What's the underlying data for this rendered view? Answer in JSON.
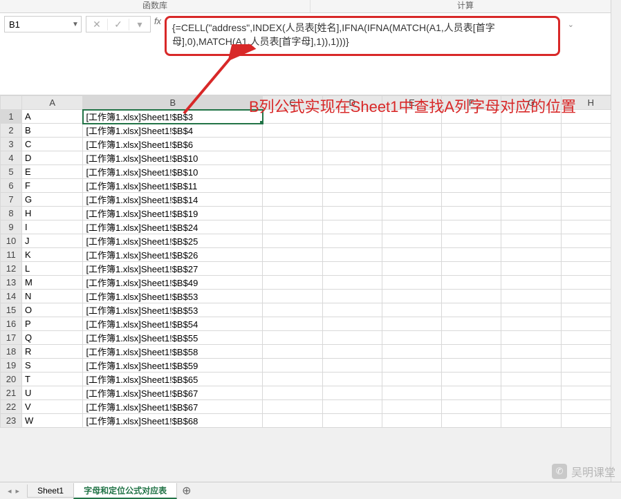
{
  "ribbon": {
    "group1": "函数库",
    "group2": "计算"
  },
  "nameBox": "B1",
  "fx_cancel": "✕",
  "fx_confirm": "✓",
  "fx_drop": "▾",
  "fx_label": "fx",
  "formula": "{=CELL(\"address\",INDEX(人员表[姓名],IFNA(IFNA(MATCH(A1,人员表[首字母],0),MATCH(A1,人员表[首字母],1)),1)))}",
  "expand_glyph": "⌄",
  "columns": [
    "A",
    "B",
    "C",
    "D",
    "E",
    "F",
    "G",
    "H"
  ],
  "annotation": "B列公式实现在Sheet1中查找A列字母对应的位置",
  "rows": [
    {
      "n": "1",
      "a": "A",
      "b": "[工作簿1.xlsx]Sheet1!$B$3"
    },
    {
      "n": "2",
      "a": "B",
      "b": "[工作簿1.xlsx]Sheet1!$B$4"
    },
    {
      "n": "3",
      "a": "C",
      "b": "[工作簿1.xlsx]Sheet1!$B$6"
    },
    {
      "n": "4",
      "a": "D",
      "b": "[工作簿1.xlsx]Sheet1!$B$10"
    },
    {
      "n": "5",
      "a": "E",
      "b": "[工作簿1.xlsx]Sheet1!$B$10"
    },
    {
      "n": "6",
      "a": "F",
      "b": "[工作簿1.xlsx]Sheet1!$B$11"
    },
    {
      "n": "7",
      "a": "G",
      "b": "[工作簿1.xlsx]Sheet1!$B$14"
    },
    {
      "n": "8",
      "a": "H",
      "b": "[工作簿1.xlsx]Sheet1!$B$19"
    },
    {
      "n": "9",
      "a": "I",
      "b": "[工作簿1.xlsx]Sheet1!$B$24"
    },
    {
      "n": "10",
      "a": "J",
      "b": "[工作簿1.xlsx]Sheet1!$B$25"
    },
    {
      "n": "11",
      "a": "K",
      "b": "[工作簿1.xlsx]Sheet1!$B$26"
    },
    {
      "n": "12",
      "a": "L",
      "b": "[工作簿1.xlsx]Sheet1!$B$27"
    },
    {
      "n": "13",
      "a": "M",
      "b": "[工作簿1.xlsx]Sheet1!$B$49"
    },
    {
      "n": "14",
      "a": "N",
      "b": "[工作簿1.xlsx]Sheet1!$B$53"
    },
    {
      "n": "15",
      "a": "O",
      "b": "[工作簿1.xlsx]Sheet1!$B$53"
    },
    {
      "n": "16",
      "a": "P",
      "b": "[工作簿1.xlsx]Sheet1!$B$54"
    },
    {
      "n": "17",
      "a": "Q",
      "b": "[工作簿1.xlsx]Sheet1!$B$55"
    },
    {
      "n": "18",
      "a": "R",
      "b": "[工作簿1.xlsx]Sheet1!$B$58"
    },
    {
      "n": "19",
      "a": "S",
      "b": "[工作簿1.xlsx]Sheet1!$B$59"
    },
    {
      "n": "20",
      "a": "T",
      "b": "[工作簿1.xlsx]Sheet1!$B$65"
    },
    {
      "n": "21",
      "a": "U",
      "b": "[工作簿1.xlsx]Sheet1!$B$67"
    },
    {
      "n": "22",
      "a": "V",
      "b": "[工作簿1.xlsx]Sheet1!$B$67"
    },
    {
      "n": "23",
      "a": "W",
      "b": "[工作簿1.xlsx]Sheet1!$B$68"
    }
  ],
  "tabs": {
    "nav_prev": "◂",
    "nav_next": "▸",
    "tab1": "Sheet1",
    "tab2": "字母和定位公式对应表",
    "add": "⊕"
  },
  "watermark": "吴明课堂",
  "watermark_icon": "✆"
}
